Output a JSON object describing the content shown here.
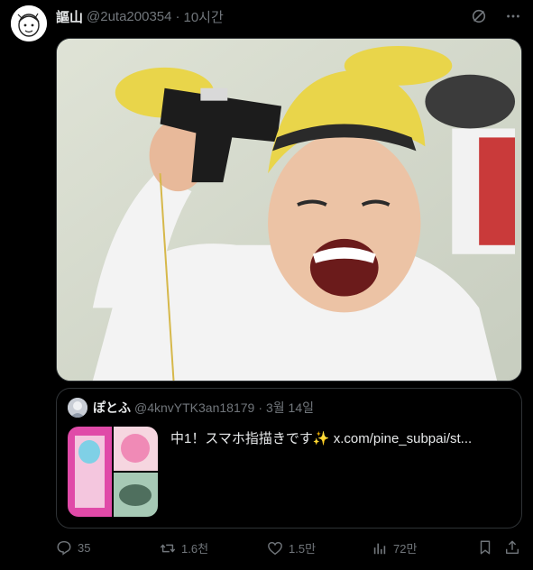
{
  "post": {
    "author_name": "謳山",
    "author_handle": "@2uta200354",
    "separator": "·",
    "time": "10시간"
  },
  "quote": {
    "author_name": "ぽとふ",
    "author_handle": "@4knvYTK3an18179",
    "separator": "·",
    "date": "3월 14일",
    "text": "中1！スマホ指描きです✨",
    "link": "x.com/pine_subpai/st..."
  },
  "actions": {
    "replies": "35",
    "reposts": "1.6천",
    "likes": "1.5만",
    "views": "72만"
  },
  "colors": {
    "background": "#000000",
    "text": "#e7e9ea",
    "muted": "#71767b",
    "border": "#2f3336"
  },
  "icons": [
    "grok-icon",
    "more-icon",
    "reply-icon",
    "repost-icon",
    "like-icon",
    "views-icon",
    "bookmark-icon",
    "share-icon"
  ]
}
